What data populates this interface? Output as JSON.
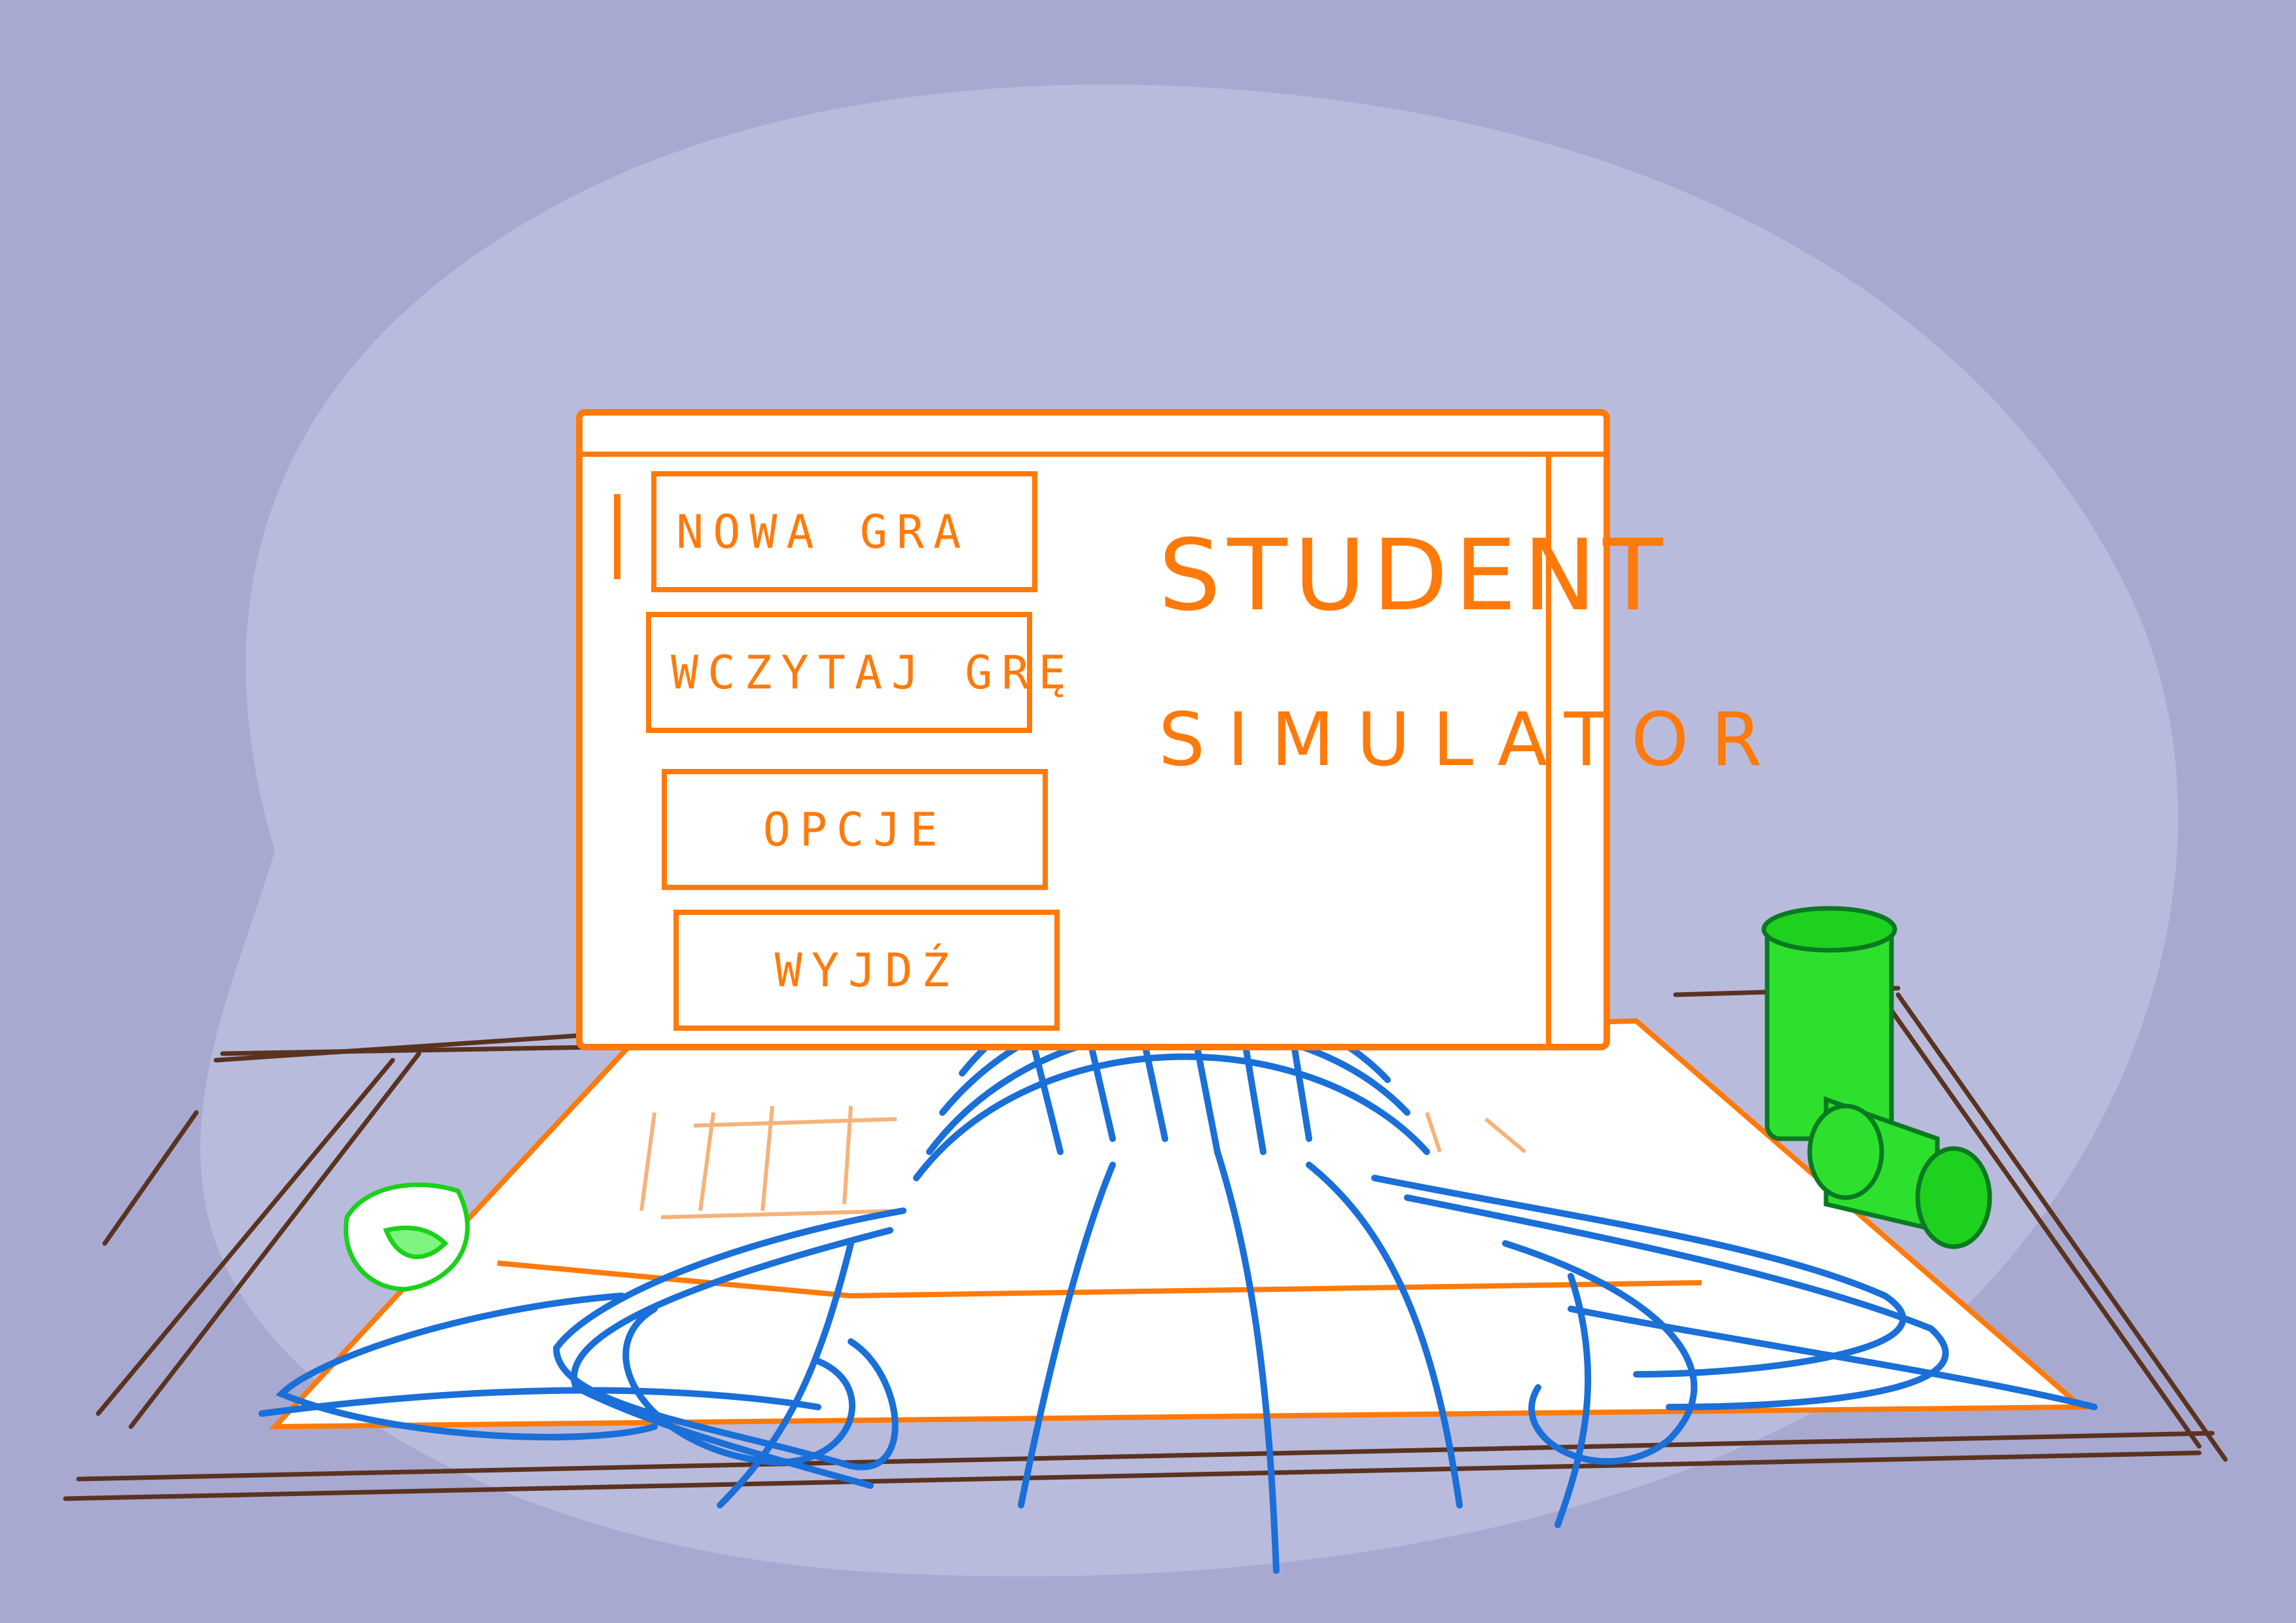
{
  "menu": {
    "new_game": "NOWA GRA",
    "load_game": "WCZYTAJ GRĘ",
    "options": "OPCJE",
    "exit": "WYJDŹ"
  },
  "title": {
    "line1": "STUDENT",
    "line2": "SIMULATOR"
  },
  "colors": {
    "background": "#a8a9d0",
    "accent": "#ff7a0a",
    "hair": "#1a6fd8",
    "can": "#22d422",
    "desk": "#5a3320"
  }
}
